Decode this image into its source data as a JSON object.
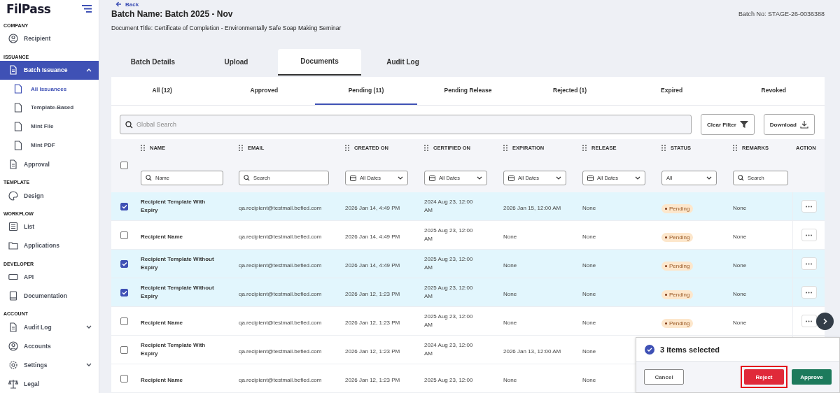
{
  "sidebar": {
    "logo": "FilPass",
    "sections": [
      {
        "title": "COMPANY",
        "items": [
          {
            "label": "Recipient",
            "selected": false
          }
        ]
      },
      {
        "title": "ISSUANCE",
        "items": [
          {
            "label": "Batch Issuance",
            "selected": true,
            "expanded": true,
            "children": [
              {
                "label": "All Issuances",
                "selected": true
              },
              {
                "label": "Template-Based",
                "selected": false
              },
              {
                "label": "Mint File",
                "selected": false
              },
              {
                "label": "Mint PDF",
                "selected": false
              }
            ]
          },
          {
            "label": "Approval",
            "selected": false
          }
        ]
      },
      {
        "title": "TEMPLATE",
        "items": [
          {
            "label": "Design",
            "selected": false
          }
        ]
      },
      {
        "title": "WORKFLOW",
        "items": [
          {
            "label": "List",
            "selected": false
          },
          {
            "label": "Applications",
            "selected": false
          }
        ]
      },
      {
        "title": "DEVELOPER",
        "items": [
          {
            "label": "API",
            "selected": false
          },
          {
            "label": "Documentation",
            "selected": false
          }
        ]
      },
      {
        "title": "ACCOUNT",
        "items": [
          {
            "label": "Audit Log",
            "selected": false,
            "expanded": false
          },
          {
            "label": "Accounts",
            "selected": false
          },
          {
            "label": "Settings",
            "selected": false,
            "expanded": false
          },
          {
            "label": "Legal",
            "selected": false
          }
        ]
      }
    ]
  },
  "header": {
    "back": "Back",
    "batch_name": "Batch Name: Batch 2025 - Nov",
    "batch_no": "Batch No: STAGE-26-0036388",
    "document_title": "Document Title: Certificate of Completion - Environmentally Safe Soap Making Seminar"
  },
  "tabs": [
    {
      "label": "Batch Details",
      "selected": false
    },
    {
      "label": "Upload",
      "selected": false
    },
    {
      "label": "Documents",
      "selected": true
    },
    {
      "label": "Audit Log",
      "selected": false
    }
  ],
  "subtabs": [
    {
      "label": "All (12)",
      "selected": false
    },
    {
      "label": "Approved",
      "selected": false
    },
    {
      "label": "Pending (11)",
      "selected": true
    },
    {
      "label": "Pending Release",
      "selected": false
    },
    {
      "label": "Rejected (1)",
      "selected": false
    },
    {
      "label": "Expired",
      "selected": false
    },
    {
      "label": "Revoked",
      "selected": false
    }
  ],
  "search": {
    "placeholder": "Global Search"
  },
  "toolbar_buttons": [
    "Clear Filter",
    "Download"
  ],
  "table": {
    "select_all": {
      "checked": false
    },
    "columns": [
      {
        "label": "NAME",
        "filter": {
          "kind": "search",
          "text": "Name"
        }
      },
      {
        "label": "EMAIL",
        "filter": {
          "kind": "search",
          "text": "Search"
        }
      },
      {
        "label": "CREATED ON",
        "filter": {
          "kind": "date",
          "text": "All Dates"
        }
      },
      {
        "label": "CERTIFIED ON",
        "filter": {
          "kind": "date",
          "text": "All Dates"
        }
      },
      {
        "label": "EXPIRATION",
        "filter": {
          "kind": "date",
          "text": "All Dates"
        }
      },
      {
        "label": "RELEASE",
        "filter": {
          "kind": "date",
          "text": "All Dates"
        }
      },
      {
        "label": "STATUS",
        "filter": {
          "kind": "select",
          "text": "All"
        }
      },
      {
        "label": "REMARKS",
        "filter": {
          "kind": "search",
          "text": "Search"
        }
      }
    ],
    "action_column": "ACTION",
    "rows": [
      {
        "selected": true,
        "name": "Recipient Template With Expiry",
        "email": "qa.recipient@testmail.befied.com",
        "created_on": "2026 Jan 14, 4:49 PM",
        "certified_on": "2024 Aug 23, 12:00 AM",
        "expiration": "2026 Jan 15, 12:00 AM",
        "release": "None",
        "status": "Pending",
        "remarks": "None"
      },
      {
        "selected": false,
        "name": "Recipient Name",
        "email": "qa.recipient@testmail.befied.com",
        "created_on": "2026 Jan 14, 4:49 PM",
        "certified_on": "2025 Aug 23, 12:00 AM",
        "expiration": "None",
        "release": "None",
        "status": "Pending",
        "remarks": "None"
      },
      {
        "selected": true,
        "name": "Recipient Template Without Expiry",
        "email": "qa.recipient@testmail.befied.com",
        "created_on": "2026 Jan 14, 4:49 PM",
        "certified_on": "2025 Aug 23, 12:00 AM",
        "expiration": "None",
        "release": "None",
        "status": "Pending",
        "remarks": "None"
      },
      {
        "selected": true,
        "name": "Recipient Template Without Expiry",
        "email": "qa.recipient@testmail.befied.com",
        "created_on": "2026 Jan 12, 1:23 PM",
        "certified_on": "2025 Aug 23, 12:00 AM",
        "expiration": "None",
        "release": "None",
        "status": "Pending",
        "remarks": "None"
      },
      {
        "selected": false,
        "name": "Recipient Name",
        "email": "qa.recipient@testmail.befied.com",
        "created_on": "2026 Jan 12, 1:23 PM",
        "certified_on": "2025 Aug 23, 12:00 AM",
        "expiration": "None",
        "release": "None",
        "status": "Pending",
        "remarks": "None"
      },
      {
        "selected": false,
        "name": "Recipient Template With Expiry",
        "email": "qa.recipient@testmail.befied.com",
        "created_on": "2026 Jan 12, 1:23 PM",
        "certified_on": "2024 Aug 23, 12:00 AM",
        "expiration": "2026 Jan 13, 12:00 AM",
        "release": "None"
      },
      {
        "selected": false,
        "name": "Recipient Name",
        "email": "qa.recipient@testmail.befied.com",
        "created_on": "2026 Jan 12, 1:23 PM",
        "certified_on": "2025 Aug 23, 12:00",
        "expiration": "None",
        "release": "None"
      }
    ]
  },
  "selection_bar": {
    "text": "3 items selected",
    "buttons": [
      {
        "label": "Cancel",
        "kind": "cancel",
        "highlighted": false
      },
      {
        "label": "Reject",
        "kind": "reject",
        "highlighted": true
      },
      {
        "label": "Approve",
        "kind": "approve",
        "highlighted": false
      }
    ]
  }
}
